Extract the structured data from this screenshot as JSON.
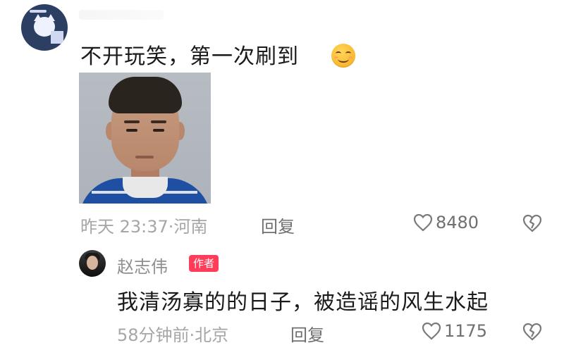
{
  "comment": {
    "text": "不开玩笑，第一次刷到",
    "emoji_icon": "smile-icon",
    "timestamp": "昨天 23:37·河南",
    "reply_label": "回复",
    "likes": "8480"
  },
  "reply": {
    "username": "赵志伟",
    "badge": "作者",
    "text": "我清汤寡的的日子，被造谣的风生水起",
    "timestamp": "58分钟前·北京",
    "reply_label": "回复",
    "likes": "1175"
  },
  "colors": {
    "badge": "#ff3c5a",
    "meta": "#a6a6a6",
    "text": "#1a1a1a"
  }
}
